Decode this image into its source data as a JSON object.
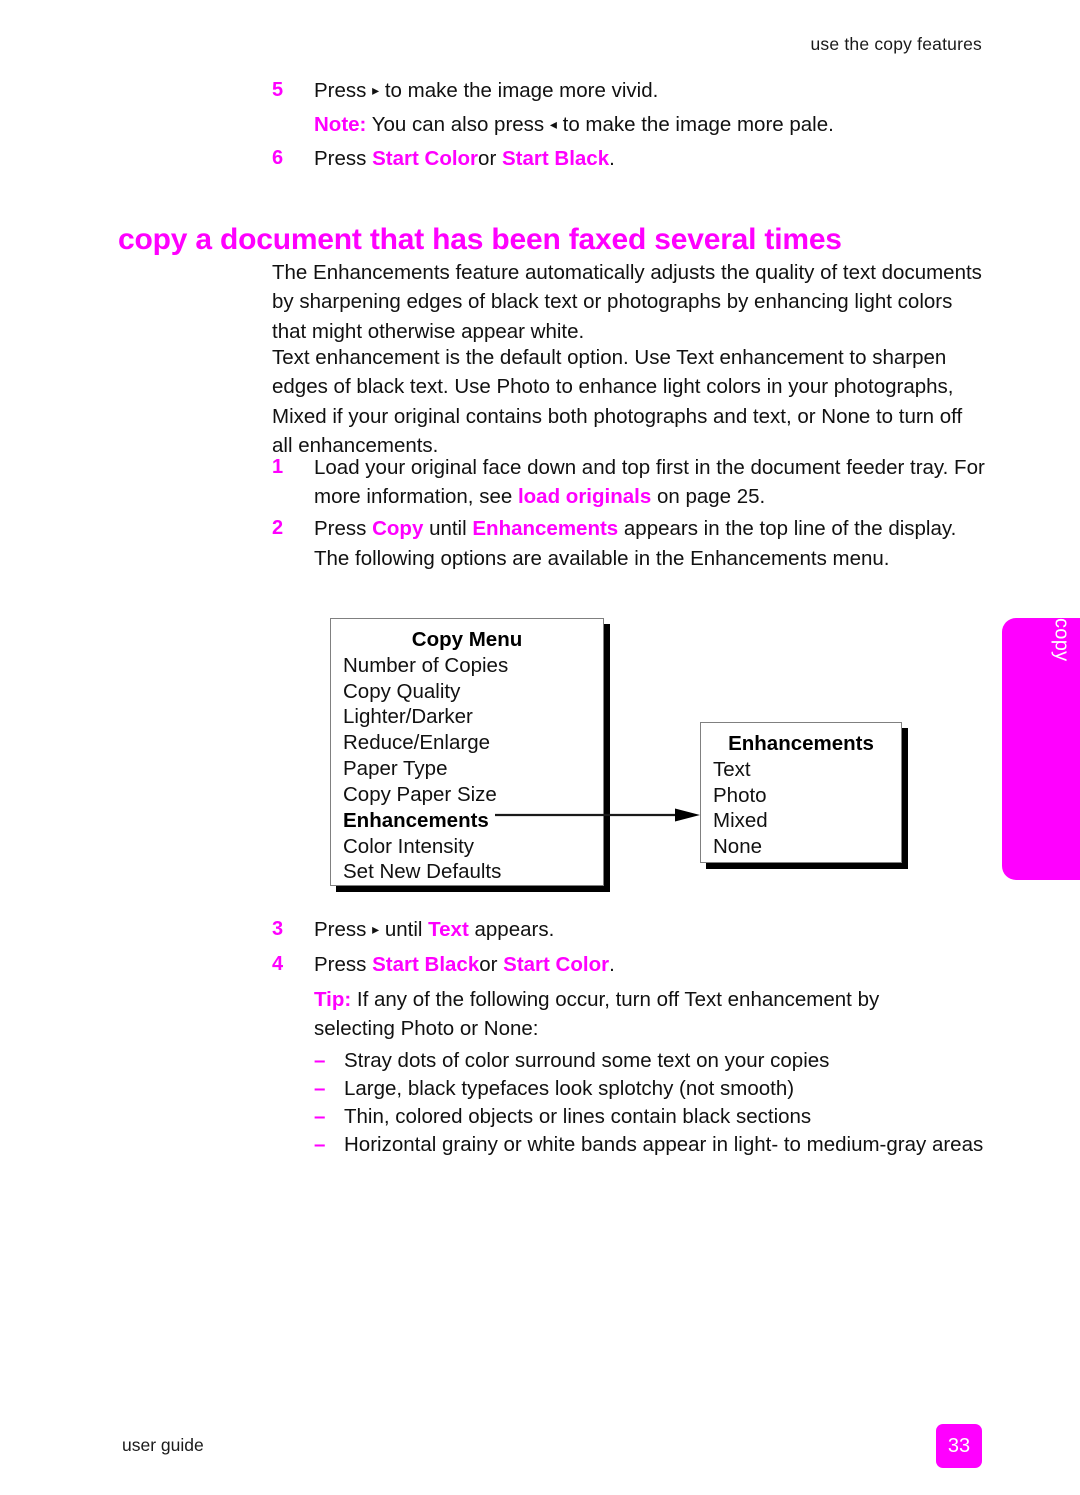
{
  "header": {
    "running_head": "use the copy features"
  },
  "top_steps": [
    {
      "num": "5",
      "prefix": "Press",
      "icon": "right-arrow-glyph",
      "icon_glyph": "▸",
      "suffix": "to make the image more vivid."
    }
  ],
  "note_line": {
    "label": "Note:",
    "prefix": "You can also press",
    "icon": "left-arrow-glyph",
    "icon_glyph": "◂",
    "suffix": "to make the image more pale."
  },
  "step6": {
    "num": "6",
    "prefix": "Press",
    "button_a": "Start Color",
    "conjunction": "or",
    "button_b": "Start Black",
    "suffix": "."
  },
  "section": {
    "heading": "copy a document that has been faxed several times",
    "paragraph_1": "The Enhancements feature automatically adjusts the quality of text documents by sharpening edges of black text or photographs by enhancing light colors that might otherwise appear white.",
    "paragraph_2": "Text enhancement is the default option. Use Text enhancement to sharpen edges of black text. Use Photo to enhance light colors in your photographs, Mixed if your original contains both photographs and text, or None to turn off all enhancements."
  },
  "procedure": {
    "step1": {
      "num": "1",
      "part_a": "Load your original face down and top first in the document feeder tray. For more information, see",
      "link": "load originals",
      "part_b": "on page 25."
    },
    "step2": {
      "num": "2",
      "part_a": "Press",
      "button": "Copy",
      "part_b": "until",
      "menu_item": "Enhancements",
      "part_c": "appears in the top line of the display.",
      "follow_line": "The following options are available in the Enhancements menu."
    },
    "step3": {
      "num": "3",
      "prefix": "Press",
      "icon": "right-arrow-glyph",
      "icon_glyph": "▸",
      "middle": "until",
      "value": "Text",
      "suffix": "appears."
    },
    "step4": {
      "num": "4",
      "prefix": "Press",
      "button_a": "Start Black",
      "conjunction": "or",
      "button_b": "Start Color",
      "suffix": "."
    }
  },
  "tip": {
    "label": "Tip:",
    "text": "If any of the following occur, turn off Text enhancement by selecting Photo or None:"
  },
  "tip_bullets": [
    {
      "mark": "–",
      "text": "Stray dots of color surround some text on your copies"
    },
    {
      "mark": "–",
      "text": "Large, black typefaces look splotchy (not smooth)"
    },
    {
      "mark": "–",
      "text": "Thin, colored objects or lines contain black sections"
    },
    {
      "mark": "–",
      "text": "Horizontal grainy or white bands appear in light- to medium-gray areas"
    }
  ],
  "diagram": {
    "copy_menu": {
      "title": "Copy Menu",
      "items": [
        {
          "label": "Number of Copies",
          "bold": false
        },
        {
          "label": "Copy Quality",
          "bold": false
        },
        {
          "label": "Lighter/Darker",
          "bold": false
        },
        {
          "label": "Reduce/Enlarge",
          "bold": false
        },
        {
          "label": "Paper Type",
          "bold": false
        },
        {
          "label": "Copy Paper Size",
          "bold": false
        },
        {
          "label": "Enhancements",
          "bold": true
        },
        {
          "label": "Color Intensity",
          "bold": false
        },
        {
          "label": "Set New Defaults",
          "bold": false
        }
      ]
    },
    "enhancements_menu": {
      "title": "Enhancements",
      "items": [
        {
          "label": "Text"
        },
        {
          "label": "Photo"
        },
        {
          "label": "Mixed"
        },
        {
          "label": "None"
        }
      ]
    },
    "connector_icon": "arrow-right-icon"
  },
  "side_tab": {
    "label": "copy"
  },
  "footer": {
    "left": "user guide",
    "page_number": "33"
  },
  "colors": {
    "accent": "#ff00ff",
    "text": "#111111",
    "box_border": "#808080",
    "shadow": "#000000"
  }
}
